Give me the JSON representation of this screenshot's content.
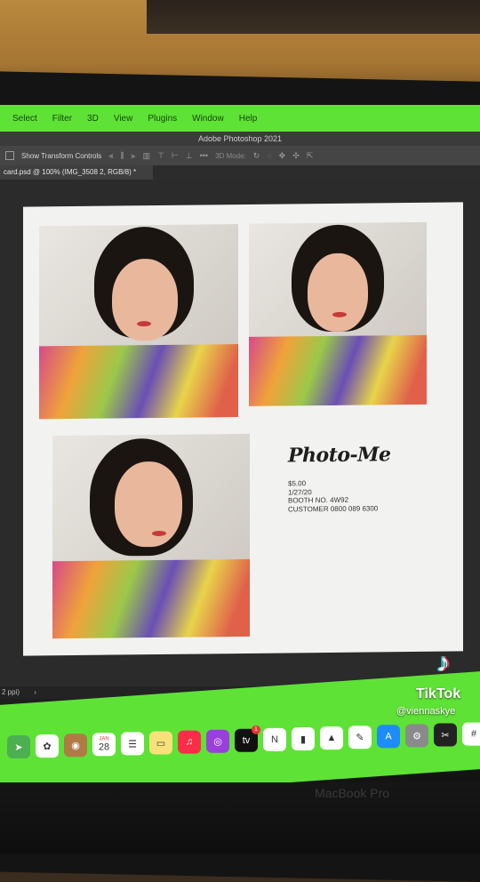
{
  "menubar": {
    "items": [
      "Select",
      "Filter",
      "3D",
      "View",
      "Plugins",
      "Window",
      "Help"
    ]
  },
  "window": {
    "title": "Adobe Photoshop 2021"
  },
  "options_bar": {
    "transform_label": "Show Transform Controls",
    "mode_label": "3D Mode:"
  },
  "document": {
    "tab_label": "card.psd @ 100% (IMG_3508 2, RGB/8) *"
  },
  "card": {
    "brand": "Photo-Me",
    "lines": [
      "$5.00",
      "1/27/20",
      "BOOTH NO. 4W92",
      "CUSTOMER 0800 089 6300"
    ]
  },
  "status_bar": {
    "resolution": "2 ppi)"
  },
  "dock": {
    "apps": [
      {
        "icon": "maps-icon",
        "color": "#4caf50",
        "glyph": "➤"
      },
      {
        "icon": "photos-icon",
        "color": "#ffffff",
        "glyph": "✿"
      },
      {
        "icon": "contacts-icon",
        "color": "#b07a45",
        "glyph": "◉"
      },
      {
        "icon": "calendar-icon",
        "color": "#ffffff",
        "glyph": "28"
      },
      {
        "icon": "reminders-icon",
        "color": "#ffffff",
        "glyph": "☰"
      },
      {
        "icon": "notes-icon",
        "color": "#f7e27a",
        "glyph": "▭"
      },
      {
        "icon": "music-icon",
        "color": "#fa2d48",
        "glyph": "♫"
      },
      {
        "icon": "podcasts-icon",
        "color": "#9b3fdc",
        "glyph": "◎"
      },
      {
        "icon": "apple-tv-icon",
        "color": "#111111",
        "glyph": "tv"
      },
      {
        "icon": "news-icon",
        "color": "#ffffff",
        "glyph": "N"
      },
      {
        "icon": "numbers-icon",
        "color": "#ffffff",
        "glyph": "▮"
      },
      {
        "icon": "keynote-icon",
        "color": "#ffffff",
        "glyph": "▲"
      },
      {
        "icon": "pages-icon",
        "color": "#ffffff",
        "glyph": "✎"
      },
      {
        "icon": "app-store-icon",
        "color": "#1d8cf8",
        "glyph": "A"
      },
      {
        "icon": "system-preferences-icon",
        "color": "#8a8a8a",
        "glyph": "⚙"
      },
      {
        "icon": "final-cut-icon",
        "color": "#222222",
        "glyph": "✂"
      },
      {
        "icon": "slack-icon",
        "color": "#ffffff",
        "glyph": "#"
      }
    ],
    "calendar_month": "JAN",
    "calendar_day": "28",
    "tv_badge": "1"
  },
  "device_label": "MacBook Pro",
  "watermark": {
    "brand": "TikTok",
    "username": "@viennaskye"
  },
  "colors": {
    "accent_green": "#5ee236",
    "artboard": "#f2f2f0"
  }
}
